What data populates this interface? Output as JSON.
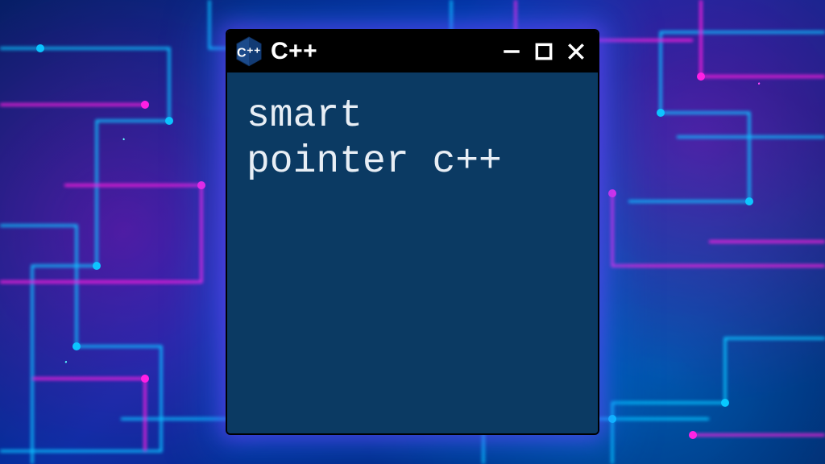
{
  "window": {
    "title": "C++",
    "body_line1": "smart",
    "body_line2": "pointer c++"
  },
  "colors": {
    "body_bg": "#0b3a63",
    "titlebar_bg": "#000000",
    "text": "#e8eef5"
  },
  "icons": {
    "logo": "cpp-logo",
    "minimize": "minimize-icon",
    "maximize": "maximize-icon",
    "close": "close-icon"
  }
}
